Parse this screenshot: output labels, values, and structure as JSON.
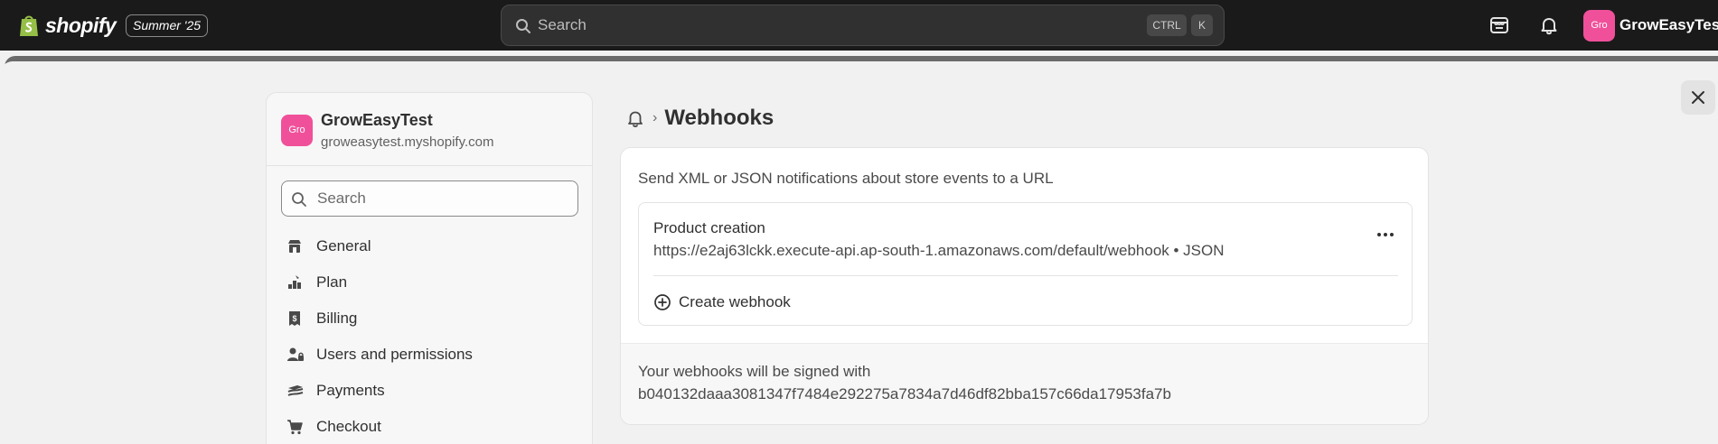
{
  "topbar": {
    "logo_text": "shopify",
    "edition": "Summer '25",
    "search_placeholder": "Search",
    "shortcut_ctrl": "CTRL",
    "shortcut_key": "K",
    "avatar_initials": "Gro",
    "shop_name": "GrowEasyTest",
    "icons": [
      "shopify-bag-icon",
      "search-icon",
      "store-icon",
      "bell-icon"
    ]
  },
  "sidebar": {
    "store_initials": "Gro",
    "store_name": "GrowEasyTest",
    "store_domain": "groweasytest.myshopify.com",
    "search_placeholder": "Search",
    "items": [
      {
        "label": "General",
        "icon": "store-icon"
      },
      {
        "label": "Plan",
        "icon": "plan-icon"
      },
      {
        "label": "Billing",
        "icon": "receipt-icon"
      },
      {
        "label": "Users and permissions",
        "icon": "users-icon"
      },
      {
        "label": "Payments",
        "icon": "payments-icon"
      },
      {
        "label": "Checkout",
        "icon": "cart-icon"
      }
    ]
  },
  "page": {
    "title": "Webhooks",
    "description": "Send XML or JSON notifications about store events to a URL",
    "webhooks": [
      {
        "event": "Product creation",
        "url_format": "https://e2aj63lckk.execute-api.ap-south-1.amazonaws.com/default/webhook • JSON"
      }
    ],
    "create_label": "Create webhook",
    "signed_label": "Your webhooks will be signed with",
    "signing_secret": "b040132daaa3081347f7484e292275a7834a7d46df82bba157c66da17953fa7b"
  },
  "colors": {
    "topbar_bg": "#1a1a1a",
    "avatar": "#f0509a",
    "shopify_green": "#95bf47"
  }
}
